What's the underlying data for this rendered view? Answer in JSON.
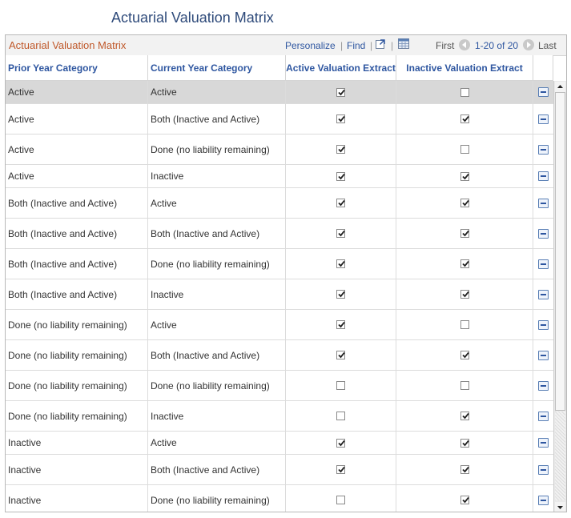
{
  "page_title": "Actuarial Valuation Matrix",
  "grid": {
    "title": "Actuarial Valuation Matrix",
    "personalize": "Personalize",
    "find": "Find",
    "separator": "|",
    "first": "First",
    "range": "1-20 of 20",
    "last": "Last",
    "columns": [
      "Prior Year Category",
      "Current Year Category",
      "Active Valuation Extract",
      "Inactive Valuation Extract"
    ]
  },
  "rows": [
    {
      "prior": "Active",
      "current": "Active",
      "active": true,
      "inactive": false
    },
    {
      "prior": "Active",
      "current": "Both (Inactive and Active)",
      "active": true,
      "inactive": true
    },
    {
      "prior": "Active",
      "current": "Done (no liability remaining)",
      "active": true,
      "inactive": false
    },
    {
      "prior": "Active",
      "current": "Inactive",
      "active": true,
      "inactive": true
    },
    {
      "prior": "Both (Inactive and Active)",
      "current": "Active",
      "active": true,
      "inactive": true
    },
    {
      "prior": "Both (Inactive and Active)",
      "current": "Both (Inactive and Active)",
      "active": true,
      "inactive": true
    },
    {
      "prior": "Both (Inactive and Active)",
      "current": "Done (no liability remaining)",
      "active": true,
      "inactive": true
    },
    {
      "prior": "Both (Inactive and Active)",
      "current": "Inactive",
      "active": true,
      "inactive": true
    },
    {
      "prior": "Done (no liability remaining)",
      "current": "Active",
      "active": true,
      "inactive": false
    },
    {
      "prior": "Done (no liability remaining)",
      "current": "Both (Inactive and Active)",
      "active": true,
      "inactive": true
    },
    {
      "prior": "Done (no liability remaining)",
      "current": "Done (no liability remaining)",
      "active": false,
      "inactive": false
    },
    {
      "prior": "Done (no liability remaining)",
      "current": "Inactive",
      "active": false,
      "inactive": true
    },
    {
      "prior": "Inactive",
      "current": "Active",
      "active": true,
      "inactive": true
    },
    {
      "prior": "Inactive",
      "current": "Both (Inactive and Active)",
      "active": true,
      "inactive": true
    },
    {
      "prior": "Inactive",
      "current": "Done (no liability remaining)",
      "active": false,
      "inactive": true
    }
  ]
}
